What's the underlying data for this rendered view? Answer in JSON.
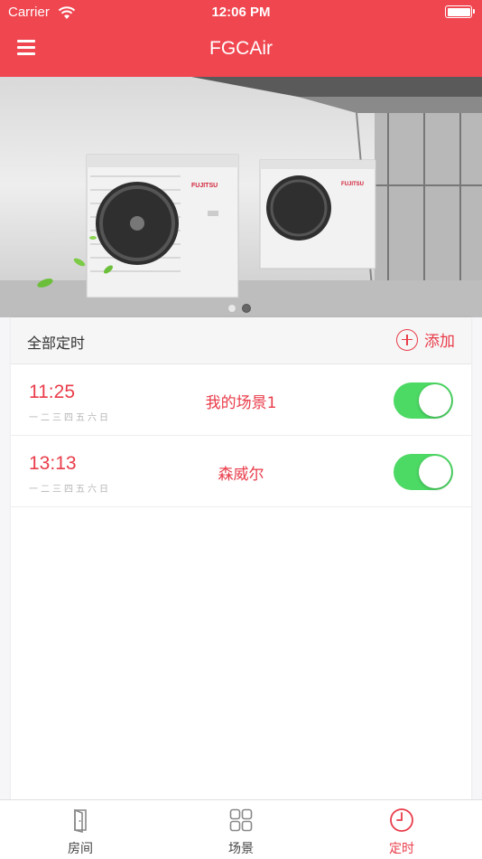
{
  "status_bar": {
    "carrier": "Carrier",
    "time": "12:06 PM"
  },
  "nav": {
    "title": "FGCAir",
    "menu_icon": "hamburger-menu-icon"
  },
  "banner": {
    "pages": 2,
    "active_page": 2,
    "brand_text": "FUJITSU"
  },
  "timers": {
    "header": "全部定时",
    "add_label": "添加",
    "items": [
      {
        "time": "11:25",
        "days": "一二三四五六日",
        "scene": "我的场景1",
        "enabled": true
      },
      {
        "time": "13:13",
        "days": "一二三四五六日",
        "scene": "森威尔",
        "enabled": true
      }
    ]
  },
  "tabs": [
    {
      "label": "房间",
      "icon": "door-icon",
      "active": false
    },
    {
      "label": "场景",
      "icon": "grid-icon",
      "active": false
    },
    {
      "label": "定时",
      "icon": "clock-icon",
      "active": true
    }
  ],
  "colors": {
    "brand": "#f04650",
    "accent": "#e93c4a",
    "switch_on": "#4cd964"
  }
}
